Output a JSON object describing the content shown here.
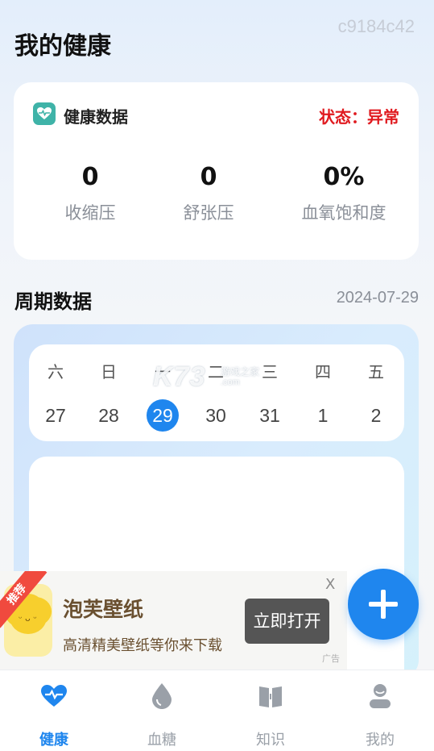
{
  "header": {
    "title": "我的健康",
    "watermark": "c9184c42"
  },
  "health_card": {
    "title": "健康数据",
    "status": "状态：异常",
    "metrics": [
      {
        "value": "0",
        "label": "收缩压"
      },
      {
        "value": "0",
        "label": "舒张压"
      },
      {
        "value": "0%",
        "label": "血氧饱和度"
      }
    ]
  },
  "cycle": {
    "title": "周期数据",
    "date": "2024-07-29",
    "days": [
      {
        "weekday": "六",
        "date": "27"
      },
      {
        "weekday": "日",
        "date": "28"
      },
      {
        "weekday": "一",
        "date": "29"
      },
      {
        "weekday": "二",
        "date": "30"
      },
      {
        "weekday": "三",
        "date": "31"
      },
      {
        "weekday": "四",
        "date": "1"
      },
      {
        "weekday": "五",
        "date": "2"
      }
    ],
    "selected_index": 2
  },
  "overlay_logo": {
    "brand": "K73",
    "tagline": "游戏之家",
    "domain": ".com"
  },
  "ad": {
    "badge": "推荐",
    "title": "泡芙壁纸",
    "subtitle": "高清精美壁纸等你来下载",
    "cta": "立即打开",
    "close": "X",
    "tag": "广告"
  },
  "tabs": [
    {
      "label": "健康",
      "icon": "heart-icon",
      "active": true
    },
    {
      "label": "血糖",
      "icon": "drop-icon",
      "active": false
    },
    {
      "label": "知识",
      "icon": "book-icon",
      "active": false
    },
    {
      "label": "我的",
      "icon": "user-icon",
      "active": false
    }
  ],
  "colors": {
    "accent": "#1f86ee",
    "alert": "#e0191e",
    "card_icon": "#3fb3a8"
  }
}
